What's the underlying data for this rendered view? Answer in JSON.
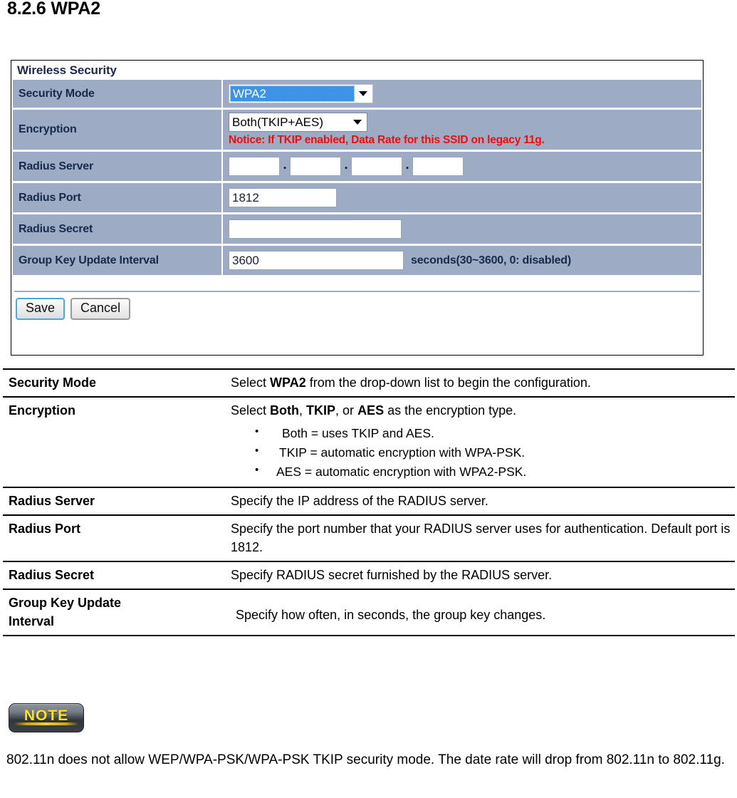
{
  "heading": "8.2.6 WPA2",
  "panel": {
    "title": "Wireless Security",
    "rows": {
      "security_mode": {
        "label": "Security Mode",
        "value": "WPA2"
      },
      "encryption": {
        "label": "Encryption",
        "value": "Both(TKIP+AES)",
        "notice": "Notice: If TKIP enabled, Data Rate for this SSID on legacy 11g."
      },
      "radius_server": {
        "label": "Radius Server",
        "octets": [
          "",
          "",
          "",
          ""
        ],
        "separator": "."
      },
      "radius_port": {
        "label": "Radius Port",
        "value": "1812"
      },
      "radius_secret": {
        "label": "Radius Secret",
        "value": ""
      },
      "group_key": {
        "label": "Group Key Update Interval",
        "value": "3600",
        "hint": "seconds(30~3600, 0: disabled)"
      }
    },
    "buttons": {
      "save": "Save",
      "cancel": "Cancel"
    }
  },
  "description_table": {
    "rows": [
      {
        "term": "Security Mode",
        "text_before": "Select ",
        "strong": "WPA2",
        "text_after": " from the drop-down list to begin the configuration."
      },
      {
        "term": "Encryption",
        "lead_1": "Select ",
        "strong_1": "Both",
        "lead_2": ", ",
        "strong_2": "TKIP",
        "lead_3": ", or ",
        "strong_3": "AES",
        "lead_4": " as the encryption type.",
        "bullets": [
          "Both = uses TKIP and AES.",
          "TKIP = automatic encryption with WPA-PSK.",
          "AES = automatic encryption with WPA2-PSK."
        ]
      },
      {
        "term": "Radius Server",
        "text": "Specify the IP address of the RADIUS server."
      },
      {
        "term": "Radius Port",
        "text": "Specify the port number that your RADIUS server uses for authentication. Default port is 1812."
      },
      {
        "term": "Radius Secret",
        "text": "Specify RADIUS secret furnished by the RADIUS server."
      },
      {
        "term_line1": "Group Key Update",
        "term_line2": "Interval",
        "text": "Specify how often, in seconds, the group key changes."
      }
    ]
  },
  "note": {
    "badge_label": "NOTE",
    "text": "802.11n does not allow WEP/WPA-PSK/WPA-PSK TKIP security mode. The date rate will drop from 802.11n to 802.11g."
  },
  "colors": {
    "row_background": "#9dacc4",
    "label_text": "#162a4d",
    "notice_red": "#f40b0b",
    "selection_blue": "#3c93e8",
    "note_yellow": "#ffe21a"
  }
}
